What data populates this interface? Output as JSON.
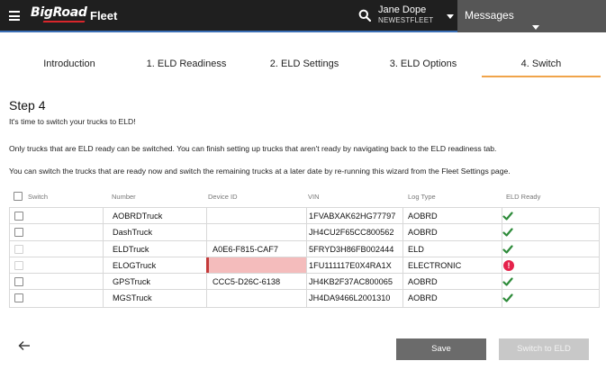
{
  "header": {
    "logo_text": "BigRoad",
    "app_title": "Fleet",
    "user_name": "Jane Dope",
    "user_org": "NEWESTFLEET",
    "messages_label": "Messages"
  },
  "tabs": [
    {
      "label": "Introduction",
      "active": false
    },
    {
      "label": "1. ELD Readiness",
      "active": false
    },
    {
      "label": "2. ELD Settings",
      "active": false
    },
    {
      "label": "3. ELD Options",
      "active": false
    },
    {
      "label": "4. Switch",
      "active": true
    }
  ],
  "step": {
    "title": "Step 4",
    "p1": "It's time to switch your trucks to ELD!",
    "p2": "Only trucks that are ELD ready can be switched. You can finish setting up trucks that aren't ready by navigating back to the ELD readiness tab.",
    "p3": "You can switch the trucks that are ready now and switch the remaining trucks at a later date by re-running this wizard from the Fleet Settings page."
  },
  "table": {
    "columns": {
      "switch": "Switch",
      "number": "Number",
      "device_id": "Device ID",
      "vin": "VIN",
      "log_type": "Log Type",
      "eld_ready": "ELD Ready"
    },
    "rows": [
      {
        "number": "AOBRDTruck",
        "device_id": "",
        "vin": "1FVABXAK62HG77797",
        "log_type": "AOBRD",
        "eld_ready": "check",
        "selectable": true
      },
      {
        "number": "DashTruck",
        "device_id": "",
        "vin": "JH4CU2F65CC800562",
        "log_type": "AOBRD",
        "eld_ready": "check",
        "selectable": true
      },
      {
        "number": "ELDTruck",
        "device_id": "A0E6-F815-CAF7",
        "vin": "5FRYD3H86FB002444",
        "log_type": "ELD",
        "eld_ready": "check",
        "selectable": false
      },
      {
        "number": "ELOGTruck",
        "device_id": "",
        "vin": "1FU111117E0X4RA1X",
        "log_type": "ELECTRONIC",
        "eld_ready": "error",
        "selectable": false
      },
      {
        "number": "GPSTruck",
        "device_id": "CCC5-D26C-6138",
        "vin": "JH4KB2F37AC800065",
        "log_type": "AOBRD",
        "eld_ready": "check",
        "selectable": true
      },
      {
        "number": "MGSTruck",
        "device_id": "",
        "vin": "JH4DA9466L2001310",
        "log_type": "AOBRD",
        "eld_ready": "check",
        "selectable": true
      }
    ],
    "error_symbol": "!"
  },
  "footer": {
    "save_label": "Save",
    "switch_label": "Switch to ELD"
  },
  "colors": {
    "topbar": "#1f1f1f",
    "accent_tab": "#f0a44a",
    "check_green": "#2e8b3a",
    "error_red": "#e5224b",
    "missing_device": "#f4bcbc"
  }
}
